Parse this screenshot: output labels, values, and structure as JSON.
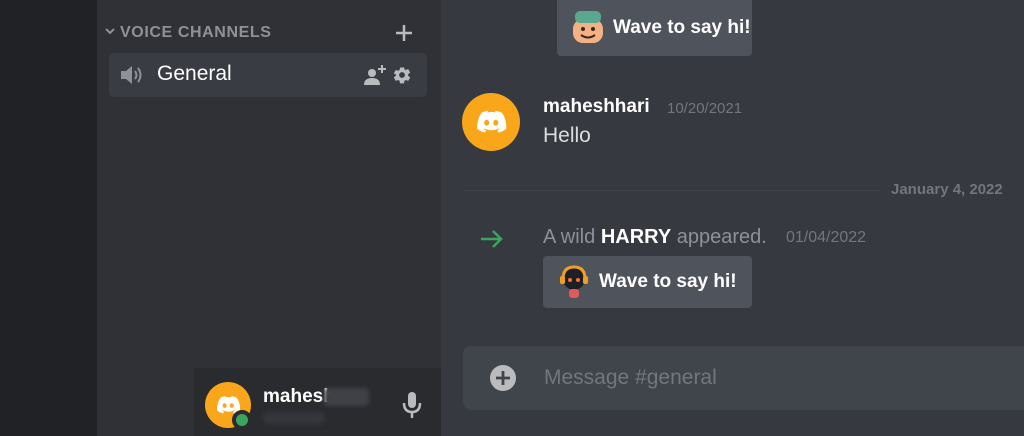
{
  "sidebar": {
    "category_label": "VOICE CHANNELS",
    "channel": {
      "name": "General"
    },
    "user": {
      "name": "mahesh"
    }
  },
  "chat": {
    "wave_label_top": "Wave to say hi!",
    "message": {
      "author": "maheshhari",
      "timestamp": "10/20/2021",
      "text": "Hello"
    },
    "date_divider": "January 4, 2022",
    "join": {
      "prefix": "A wild ",
      "name": "HARRY",
      "suffix": " appeared.",
      "timestamp": "01/04/2022"
    },
    "wave_label_bottom": "Wave to say hi!",
    "composer_placeholder": "Message #general"
  },
  "colors": {
    "sidebar_bg": "#2f3136",
    "chat_bg": "#36393f",
    "blurple_avatar": "#faa61a",
    "online_status": "#3ba55d",
    "annotation_arrow": "#ed1c24",
    "join_arrow": "#3ba55d"
  },
  "icons": [
    "chevron-down-icon",
    "plus-icon",
    "speaker-icon",
    "invite-member-icon",
    "gear-icon",
    "discord-logo-icon",
    "mic-icon",
    "headphones-icon",
    "arrow-right-icon",
    "add-attachment-icon"
  ]
}
